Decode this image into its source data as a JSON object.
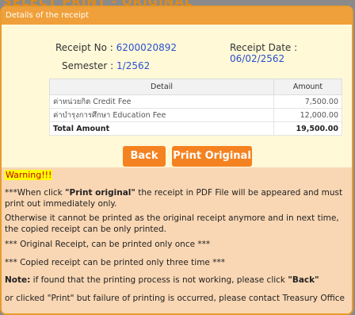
{
  "page_heading": "SELECT PRINT - ORIGINAL",
  "panel": {
    "header": "Details of the receipt"
  },
  "receipt": {
    "no_label": "Receipt No :",
    "no_value": "6200020892",
    "date_label": "Receipt Date :",
    "date_value": "06/02/2562",
    "semester_label": "Semester :",
    "semester_value": "1/2562"
  },
  "table": {
    "headers": [
      "Detail",
      "Amount"
    ],
    "rows": [
      {
        "detail": "ค่าหน่วยกิต Credit Fee",
        "amount": "7,500.00"
      },
      {
        "detail": "ค่าบำรุงการศึกษา Education Fee",
        "amount": "12,000.00"
      }
    ],
    "total": {
      "label": "Total Amount",
      "amount": "19,500.00"
    }
  },
  "buttons": {
    "back": "Back",
    "print": "Print Original"
  },
  "warning": {
    "title": "Warning!!!",
    "line1_pre": "***When click ",
    "line1_bold": "\"Print original\"",
    "line1_post": " the receipt in PDF File will be appeared and must print out immediately only.",
    "line2": "Otherwise it cannot be printed as the original receipt anymore and in next time, the copied receipt can be only printed.",
    "line3": "*** Original Receipt, can be printed only once ***",
    "line4": "*** Copied receipt can be printed only three time ***",
    "line5_bold": "Note:",
    "line5_pre": " if found that the printing process is not working, please click ",
    "line5_bold2": "\"Back\"",
    "line6": "or clicked \"Print\" but failure of printing is occurred, please contact Treasury Office"
  },
  "colors": {
    "accent": "#f58220",
    "panel_header": "#f0a03a",
    "value_blue": "#2a4fcf",
    "warning_bg": "#fad7b4"
  }
}
